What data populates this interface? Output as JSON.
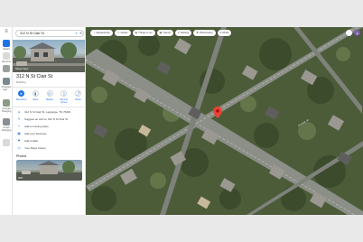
{
  "search": {
    "query": "312 N St Clair St"
  },
  "rail": {
    "items": [
      {
        "label": "Saved"
      },
      {
        "label": "Recents"
      },
      {
        "label": ""
      },
      {
        "label": "Chargers near ..."
      },
      {
        "label": "Georgia Charging"
      },
      {
        "label": "Smart Charging"
      },
      {
        "label": ""
      }
    ]
  },
  "place": {
    "title": "312 N St Clair St",
    "subtitle": "Building",
    "hero_label": "Street View"
  },
  "actions": [
    {
      "label": "Directions",
      "icon": "directions-icon",
      "primary": true
    },
    {
      "label": "Save",
      "icon": "bookmark-icon",
      "primary": false
    },
    {
      "label": "Nearby",
      "icon": "nearby-icon",
      "primary": false
    },
    {
      "label": "Send to phone",
      "icon": "phone-icon",
      "primary": false
    },
    {
      "label": "Share",
      "icon": "share-icon",
      "primary": false
    }
  ],
  "info": [
    {
      "icon": "pin-icon",
      "text": "312 N St Clair St, Lagrange, TN 76490"
    },
    {
      "icon": "edit-icon",
      "text": "Suggest an edit on 312 N St Clair St"
    },
    {
      "icon": "add-place-icon",
      "text": "Add a missing place"
    },
    {
      "icon": "business-icon",
      "text": "Add your business"
    },
    {
      "icon": "label-icon",
      "text": "Add a label"
    },
    {
      "icon": "history-icon",
      "text": "Your Maps history"
    }
  ],
  "photos": {
    "title": "Photos",
    "photo_label": "360°"
  },
  "chips": [
    {
      "icon": "fork-icon",
      "label": "Restaurants"
    },
    {
      "icon": "hotel-icon",
      "label": "Hotels"
    },
    {
      "icon": "camera-icon",
      "label": "Things to do"
    },
    {
      "icon": "transit-icon",
      "label": "Transit"
    },
    {
      "icon": "parking-icon",
      "label": "Parking"
    },
    {
      "icon": "pharmacy-icon",
      "label": "Pharmacies"
    },
    {
      "icon": "atm-icon",
      "label": "ATMs"
    }
  ],
  "map": {
    "street_label": "St Clair St"
  },
  "colors": {
    "accent": "#1a73e8",
    "pin": "#ea4335"
  }
}
